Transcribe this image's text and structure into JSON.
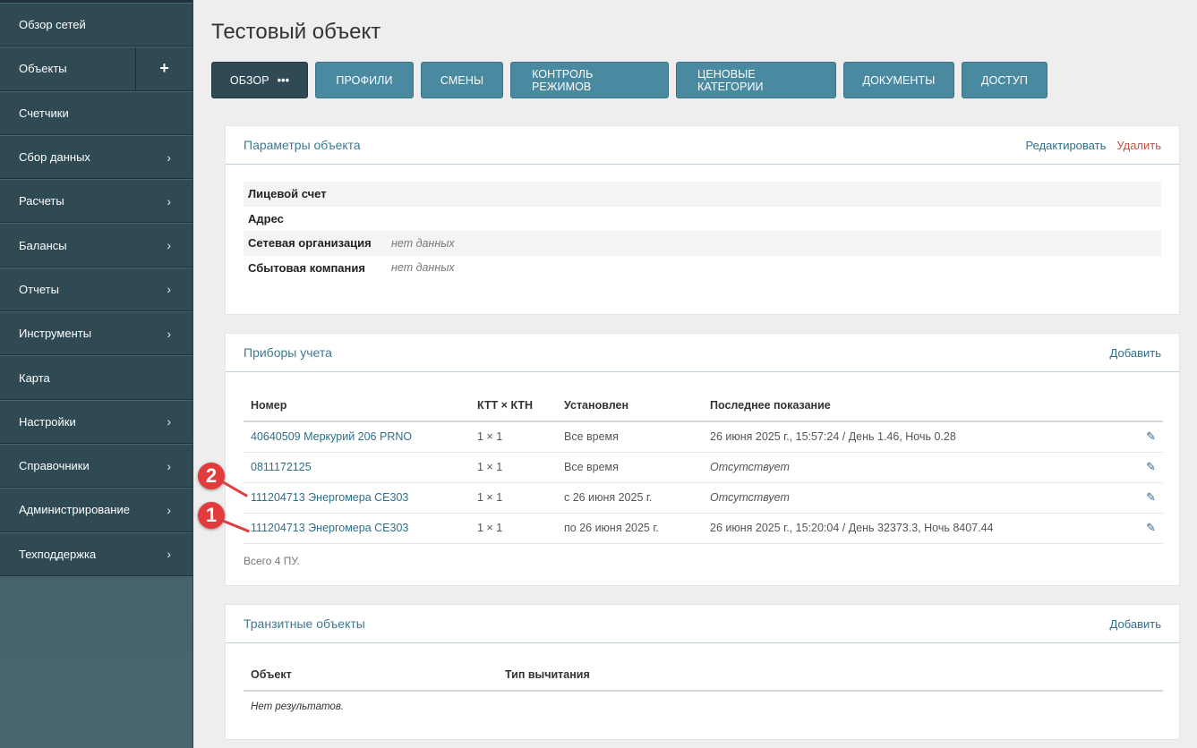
{
  "sidebar": {
    "items": [
      {
        "label": "Обзор сетей",
        "chevron": false
      },
      {
        "label": "Объекты",
        "chevron": false,
        "plus": "+"
      },
      {
        "label": "Счетчики",
        "chevron": false
      },
      {
        "label": "Сбор данных",
        "chevron": true
      },
      {
        "label": "Расчеты",
        "chevron": true
      },
      {
        "label": "Балансы",
        "chevron": true
      },
      {
        "label": "Отчеты",
        "chevron": true
      },
      {
        "label": "Инструменты",
        "chevron": true
      },
      {
        "label": "Карта",
        "chevron": false
      },
      {
        "label": "Настройки",
        "chevron": true
      },
      {
        "label": "Справочники",
        "chevron": true
      },
      {
        "label": "Администрирование",
        "chevron": true
      },
      {
        "label": "Техподдержка",
        "chevron": true
      }
    ]
  },
  "page": {
    "title": "Тестовый объект"
  },
  "tabs": [
    {
      "label": "ОБЗОР",
      "active": true,
      "dots": "•••"
    },
    {
      "label": "ПРОФИЛИ"
    },
    {
      "label": "СМЕНЫ"
    },
    {
      "label": "КОНТРОЛЬ РЕЖИМОВ"
    },
    {
      "label": "ЦЕНОВЫЕ КАТЕГОРИИ"
    },
    {
      "label": "ДОКУМЕНТЫ"
    },
    {
      "label": "ДОСТУП"
    }
  ],
  "params_panel": {
    "title": "Параметры объекта",
    "edit_label": "Редактировать",
    "delete_label": "Удалить",
    "rows": [
      {
        "key": "Лицевой счет",
        "value": ""
      },
      {
        "key": "Адрес",
        "value": ""
      },
      {
        "key": "Сетевая организация",
        "value": "нет данных"
      },
      {
        "key": "Сбытовая компания",
        "value": "нет данных"
      }
    ]
  },
  "meters_panel": {
    "title": "Приборы учета",
    "add_label": "Добавить",
    "columns": [
      "Номер",
      "КТТ × КТН",
      "Установлен",
      "Последнее показание"
    ],
    "rows": [
      {
        "number": "40640509 Меркурий 206 PRNO",
        "ratio": "1 × 1",
        "installed": "Все время",
        "last": "26 июня 2025 г., 15:57:24 / День 1.46, Ночь 0.28",
        "italic": false
      },
      {
        "number": "0811172125",
        "ratio": "1 × 1",
        "installed": "Все время",
        "last": "Отсутствует",
        "italic": true
      },
      {
        "number": "111204713 Энергомера CE303",
        "ratio": "1 × 1",
        "installed": "с 26 июня 2025 г.",
        "last": "Отсутствует",
        "italic": true
      },
      {
        "number": "111204713 Энергомера CE303",
        "ratio": "1 × 1",
        "installed": "по 26 июня 2025 г.",
        "last": "26 июня 2025 г., 15:20:04 / День 32373.3, Ночь 8407.44",
        "italic": false
      }
    ],
    "total": "Всего 4 ПУ."
  },
  "transit_panel": {
    "title": "Транзитные объекты",
    "add_label": "Добавить",
    "columns": [
      "Объект",
      "Тип вычитания"
    ],
    "empty_text": "Нет результатов."
  },
  "markers": [
    {
      "label": "2"
    },
    {
      "label": "1"
    }
  ],
  "colors": {
    "sidebar_bg": "#2f4a53",
    "tab_bg": "#4a8aa0",
    "tab_active_bg": "#2f4a55",
    "link": "#2f6f88",
    "delete": "#c0533c",
    "marker": "#e23b3b"
  }
}
